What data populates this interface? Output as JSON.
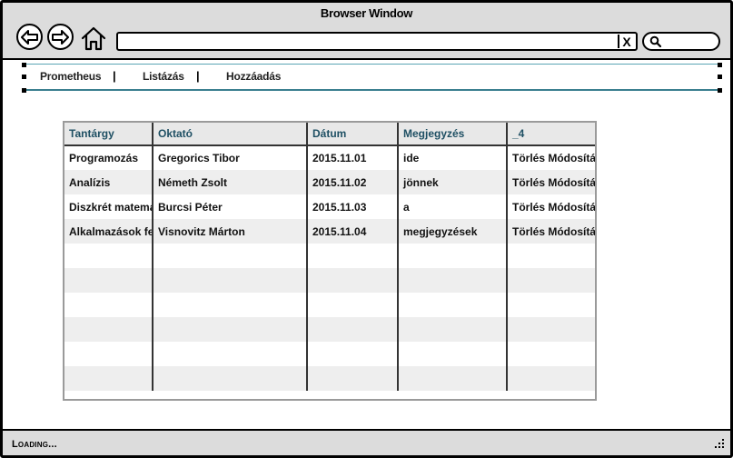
{
  "window": {
    "title": "Browser Window"
  },
  "toolbar": {
    "back_icon": "arrow-left-icon",
    "forward_icon": "arrow-right-icon",
    "home_icon": "home-icon",
    "address_value": "",
    "clear_label": "X",
    "search_value": ""
  },
  "menu": {
    "items": [
      "Prometheus",
      "Listázás",
      "Hozzáadás"
    ],
    "separator": "|"
  },
  "table": {
    "columns": [
      "Tantárgy",
      "Oktató",
      "Dátum",
      "Megjegyzés",
      "_4"
    ],
    "rows": [
      [
        "Programozás",
        "Gregorics Tibor",
        "2015.11.01",
        "ide",
        "Törlés Módosítás"
      ],
      [
        "Analízis",
        "Németh Zsolt",
        "2015.11.02",
        "jönnek",
        "Törlés Módosítás"
      ],
      [
        "Diszkrét matematika",
        "Burcsi Péter",
        "2015.11.03",
        "a",
        "Törlés Módosítás"
      ],
      [
        "Alkalmazások fejlesztése",
        "Visnovitz Márton",
        "2015.11.04",
        "megjegyzések",
        "Törlés Módosítás"
      ],
      [
        "",
        "",
        "",
        "",
        ""
      ],
      [
        "",
        "",
        "",
        "",
        ""
      ],
      [
        "",
        "",
        "",
        "",
        ""
      ],
      [
        "",
        "",
        "",
        "",
        ""
      ],
      [
        "",
        "",
        "",
        "",
        ""
      ],
      [
        "",
        "",
        "",
        "",
        ""
      ]
    ]
  },
  "status": {
    "text": "Loading..."
  },
  "colors": {
    "chrome": "#dcdcdc",
    "header_text": "#1e4f63",
    "menu_underline": "#3a7f8f",
    "alt_row": "#eeeeee"
  }
}
